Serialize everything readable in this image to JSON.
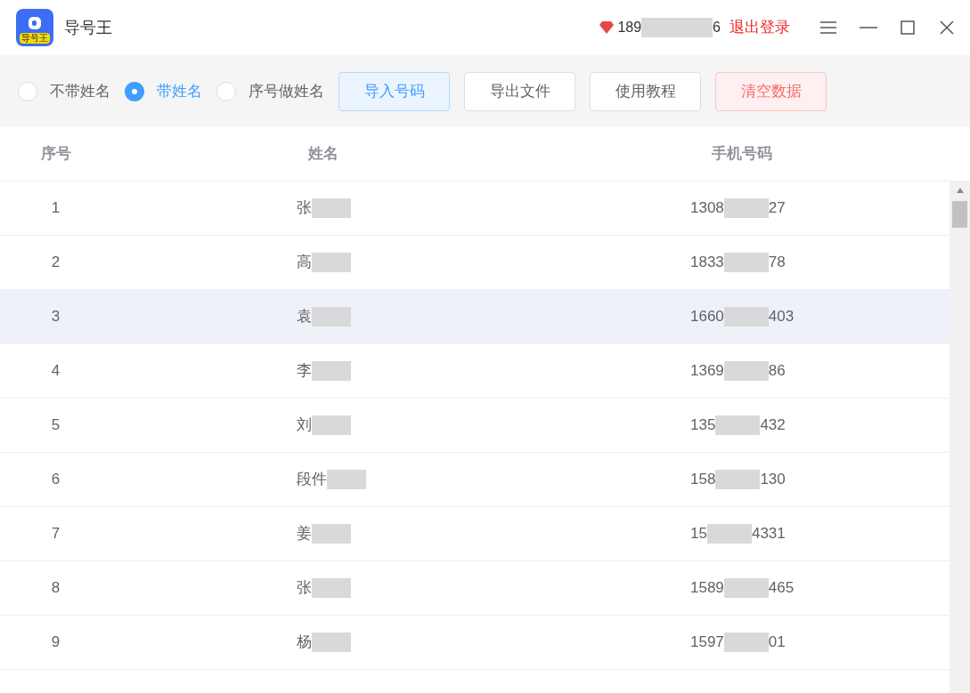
{
  "app": {
    "title": "导号王",
    "logo_text": "导号王"
  },
  "account": {
    "phone_start": "189",
    "phone_end": "6",
    "logout": "退出登录"
  },
  "modes": [
    {
      "label": "不带姓名",
      "selected": false
    },
    {
      "label": "带姓名",
      "selected": true
    },
    {
      "label": "序号做姓名",
      "selected": false
    }
  ],
  "buttons": [
    {
      "label": "导入号码",
      "kind": "primary"
    },
    {
      "label": "导出文件",
      "kind": "default"
    },
    {
      "label": "使用教程",
      "kind": "default"
    },
    {
      "label": "清空数据",
      "kind": "danger"
    }
  ],
  "table": {
    "columns": [
      "序号",
      "姓名",
      "手机号码"
    ],
    "rows": [
      {
        "index": "1",
        "name": "张",
        "phone_start": "1308",
        "phone_end": "27",
        "selected": false
      },
      {
        "index": "2",
        "name": "高",
        "phone_start": "1833",
        "phone_end": "78",
        "selected": false
      },
      {
        "index": "3",
        "name": "袁",
        "phone_start": "1660",
        "phone_end": "403",
        "selected": true
      },
      {
        "index": "4",
        "name": "李",
        "phone_start": "1369",
        "phone_end": "86",
        "selected": false
      },
      {
        "index": "5",
        "name": "刘",
        "phone_start": "135",
        "phone_end": "432",
        "selected": false
      },
      {
        "index": "6",
        "name": "段件",
        "phone_start": "158",
        "phone_end": "130",
        "selected": false
      },
      {
        "index": "7",
        "name": "姜",
        "phone_start": "15",
        "phone_end": "4331",
        "selected": false
      },
      {
        "index": "8",
        "name": "张",
        "phone_start": "1589",
        "phone_end": "465",
        "selected": false
      },
      {
        "index": "9",
        "name": "杨",
        "phone_start": "1597",
        "phone_end": "01",
        "selected": false
      }
    ]
  }
}
